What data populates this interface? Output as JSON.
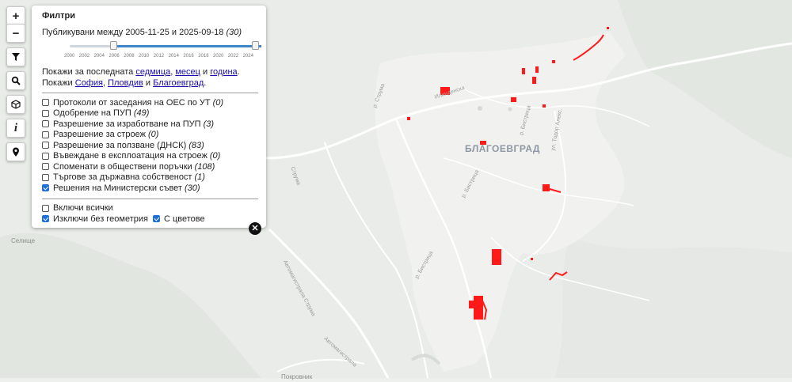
{
  "map": {
    "city_label": "БЛАГОЕВГРАД",
    "place_labels": {
      "selishte": "Селище",
      "pokrovnik": "Покровник"
    },
    "road_labels": {
      "r1": "Илинденска",
      "r2": "Автомагистрала Струма",
      "r3": "Автомагистрала",
      "r4": "р. Бистрица",
      "r5": "р. Бистрица",
      "r6": "Струма",
      "r7": "р. Струма",
      "r8": "ул. Тодор Алекс.",
      "r9": "р. Бистрица"
    },
    "feature_color": "#ff1a1a"
  },
  "controls": {
    "zoom_in": "+",
    "zoom_out": "−",
    "filter_icon": "filter-icon",
    "search_icon": "search-icon",
    "cube_icon": "cube-icon",
    "info": "i",
    "location_icon": "pin-icon"
  },
  "panel": {
    "title": "Филтри",
    "range_prefix": "Публикувани между",
    "range_from": "2005-11-25",
    "range_and": "и",
    "range_to": "2025-09-18",
    "range_count": "(30)",
    "slider": {
      "min_year": 2000,
      "max_year": 2025,
      "from_year": 2005.9,
      "to_year": 2025.7
    },
    "ticks": [
      "2000",
      "2002",
      "2004",
      "2006",
      "2008",
      "2010",
      "2012",
      "2014",
      "2016",
      "2018",
      "2020",
      "2022",
      "2024"
    ],
    "quick1_prefix": "Покажи за последната",
    "quick_week": "седмица",
    "quick_month": "месец",
    "quick_and": "и",
    "quick_year": "година",
    "quick2_prefix": "Покажи",
    "city_sofia": "София",
    "city_plovdiv": "Пловдив",
    "city_and": "и",
    "city_blagoevgrad": "Благоевград",
    "options": [
      {
        "label": "Протоколи от заседания на ОЕС по УТ",
        "count": "(0)",
        "checked": false
      },
      {
        "label": "Одобрение на ПУП",
        "count": "(49)",
        "checked": false
      },
      {
        "label": "Разрешение за изработване на ПУП",
        "count": "(3)",
        "checked": false
      },
      {
        "label": "Разрешение за строеж",
        "count": "(0)",
        "checked": false
      },
      {
        "label": "Разрешение за ползване (ДНСК)",
        "count": "(83)",
        "checked": false
      },
      {
        "label": "Въвеждане в експлоатация на строеж",
        "count": "(0)",
        "checked": false
      },
      {
        "label": "Споменати в обществени поръчки",
        "count": "(108)",
        "checked": false
      },
      {
        "label": "Търгове за държавна собственост",
        "count": "(1)",
        "checked": false
      },
      {
        "label": "Решения на Министерски съвет",
        "count": "(30)",
        "checked": true
      }
    ],
    "include_all": {
      "label": "Включи всички",
      "checked": false
    },
    "exclude_no_geom": {
      "label": "Изключи без геометрия",
      "checked": true
    },
    "with_colors": {
      "label": "С цветове",
      "checked": true
    },
    "close_symbol": "✕"
  }
}
